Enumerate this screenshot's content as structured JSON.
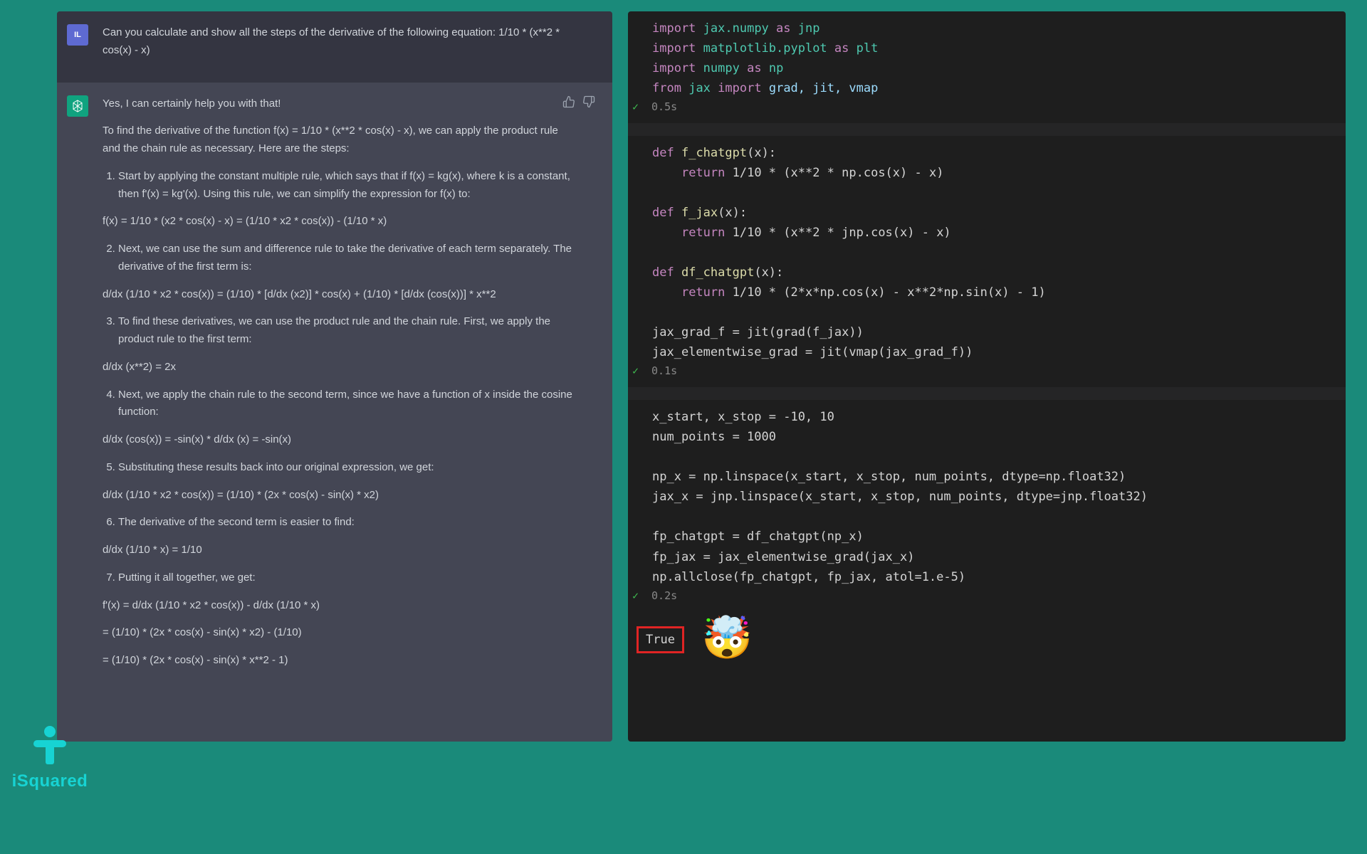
{
  "chat": {
    "user": {
      "avatar_initials": "IL",
      "prompt": "Can you calculate and show all the steps of the derivative of the following equation: 1/10 * (x**2 * cos(x) - x)"
    },
    "ai": {
      "intro": "Yes, I can certainly help you with that!",
      "para_find": "To find the derivative of the function f(x) = 1/10 * (x**2 * cos(x) - x), we can apply the product rule and the chain rule as necessary. Here are the steps:",
      "step1": "Start by applying the constant multiple rule, which says that if f(x) = kg(x), where k is a constant, then f'(x) = kg'(x). Using this rule, we can simplify the expression for f(x) to:",
      "eq1": "f(x) = 1/10 * (x2 * cos(x) - x) = (1/10 * x2 * cos(x)) - (1/10 * x)",
      "step2": "Next, we can use the sum and difference rule to take the derivative of each term separately. The derivative of the first term is:",
      "eq2": "d/dx (1/10 * x2 * cos(x)) = (1/10) * [d/dx (x2)] * cos(x) + (1/10) * [d/dx (cos(x))] * x**2",
      "step3": "To find these derivatives, we can use the product rule and the chain rule. First, we apply the product rule to the first term:",
      "eq3": "d/dx (x**2) = 2x",
      "step4": "Next, we apply the chain rule to the second term, since we have a function of x inside the cosine function:",
      "eq4": "d/dx (cos(x)) = -sin(x) * d/dx (x) = -sin(x)",
      "step5": "Substituting these results back into our original expression, we get:",
      "eq5": "d/dx (1/10 * x2 * cos(x)) = (1/10) * (2x * cos(x) - sin(x) * x2)",
      "step6": "The derivative of the second term is easier to find:",
      "eq6": "d/dx (1/10 * x) = 1/10",
      "step7": "Putting it all together, we get:",
      "eq7a": "f'(x) = d/dx (1/10 * x2 * cos(x)) - d/dx (1/10 * x)",
      "eq7b": "= (1/10) * (2x * cos(x) - sin(x) * x2) - (1/10)",
      "eq7c": "= (1/10) * (2x * cos(x) - sin(x) * x**2 - 1)"
    }
  },
  "code": {
    "cell1": {
      "line1": {
        "kw1": "import",
        "mod": "jax.numpy",
        "kw2": "as",
        "alias": "jnp"
      },
      "line2": {
        "kw1": "import",
        "mod": "matplotlib.pyplot",
        "kw2": "as",
        "alias": "plt"
      },
      "line3": {
        "kw1": "import",
        "mod": "numpy",
        "kw2": "as",
        "alias": "np"
      },
      "line4": {
        "kw1": "from",
        "mod": "jax",
        "kw2": "import",
        "names": "grad, jit, vmap"
      },
      "time": "0.5s"
    },
    "cell2": {
      "def1": {
        "kw": "def",
        "name": "f_chatgpt",
        "sig": "(x):"
      },
      "ret1": {
        "kw": "return",
        "body": "1/10 * (x**2 * np.cos(x) - x)"
      },
      "def2": {
        "kw": "def",
        "name": "f_jax",
        "sig": "(x):"
      },
      "ret2": {
        "kw": "return",
        "body": "1/10 * (x**2 * jnp.cos(x) - x)"
      },
      "def3": {
        "kw": "def",
        "name": "df_chatgpt",
        "sig": "(x):"
      },
      "ret3": {
        "kw": "return",
        "body": "1/10 * (2*x*np.cos(x) - x**2*np.sin(x) - 1)"
      },
      "assign1": "jax_grad_f = jit(grad(f_jax))",
      "assign2": "jax_elementwise_grad = jit(vmap(jax_grad_f))",
      "time": "0.1s"
    },
    "cell3": {
      "l1": "x_start, x_stop = -10, 10",
      "l2": "num_points = 1000",
      "l3": "np_x = np.linspace(x_start, x_stop, num_points, dtype=np.float32)",
      "l4": "jax_x = jnp.linspace(x_start, x_stop, num_points, dtype=jnp.float32)",
      "l5": "fp_chatgpt = df_chatgpt(np_x)",
      "l6": "fp_jax = jax_elementwise_grad(jax_x)",
      "l7": "np.allclose(fp_chatgpt, fp_jax, atol=1.e-5)",
      "time": "0.2s",
      "output": "True"
    }
  },
  "watermark": {
    "label": "iSquared"
  }
}
